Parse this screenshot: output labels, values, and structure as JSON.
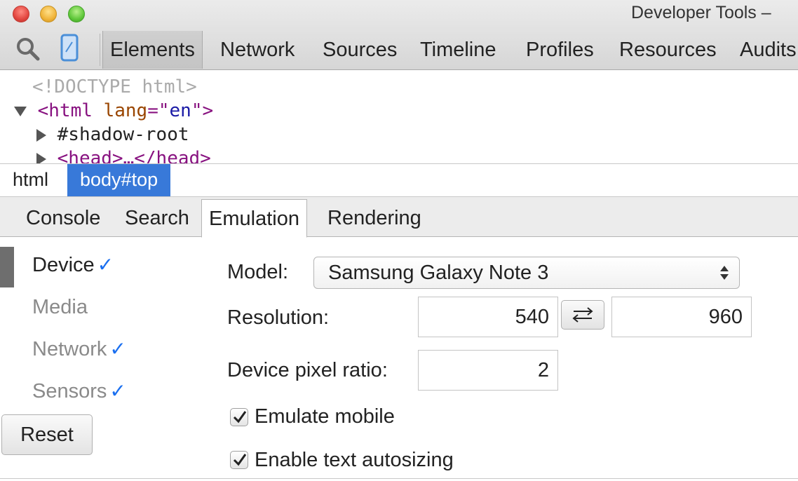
{
  "window": {
    "title": "Developer Tools – "
  },
  "toolbar": {
    "search_icon": "magnifier-icon",
    "device_icon": "mobile-device-icon",
    "tabs": [
      "Elements",
      "Network",
      "Sources",
      "Timeline",
      "Profiles",
      "Resources",
      "Audits"
    ],
    "active_tab": "Elements"
  },
  "dom_tree": {
    "doctype": "<!DOCTYPE html>",
    "html_open": "<html",
    "html_attr_name": "lang",
    "html_attr_eq": "=\"",
    "html_attr_value": "en",
    "html_attr_close": "\">",
    "shadow_root": "#shadow-root",
    "head": "<head>…</head>"
  },
  "breadcrumbs": [
    "html",
    "body#top"
  ],
  "drawer": {
    "tabs": [
      "Console",
      "Search",
      "Emulation",
      "Rendering"
    ],
    "active_tab": "Emulation"
  },
  "emulation": {
    "sidebar": [
      {
        "label": "Device",
        "checked": true
      },
      {
        "label": "Media",
        "checked": false
      },
      {
        "label": "Network",
        "checked": true
      },
      {
        "label": "Sensors",
        "checked": true
      }
    ],
    "reset_label": "Reset",
    "model_label": "Model:",
    "model_value": "Samsung Galaxy Note 3",
    "resolution_label": "Resolution:",
    "resolution_width": "540",
    "resolution_height": "960",
    "swap_icon": "swap-arrows-icon",
    "dpr_label": "Device pixel ratio:",
    "dpr_value": "2",
    "emulate_mobile_label": "Emulate mobile",
    "emulate_mobile_checked": true,
    "text_autosizing_label": "Enable text autosizing",
    "text_autosizing_checked": true
  },
  "colors": {
    "accent": "#3879d9",
    "checkmark": "#1a6ff0",
    "tag": "#881280",
    "attr": "#994500",
    "value": "#1a1aa6"
  }
}
